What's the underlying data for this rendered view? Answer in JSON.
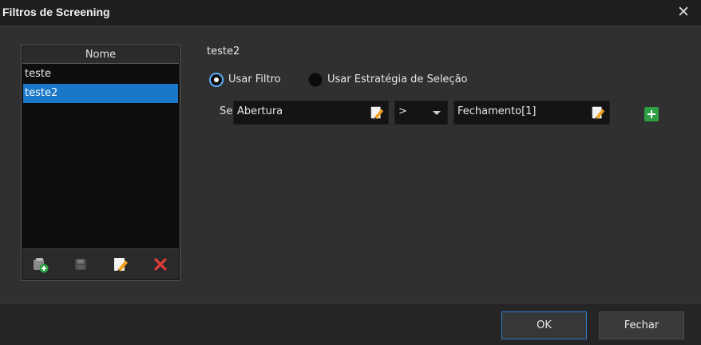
{
  "window": {
    "title": "Filtros de Screening"
  },
  "list": {
    "header": "Nome",
    "items": [
      {
        "label": "teste",
        "selected": false
      },
      {
        "label": "teste2",
        "selected": true
      }
    ],
    "toolbar": {
      "icons": [
        "add-folder-icon",
        "save-icon",
        "edit-icon",
        "delete-icon"
      ]
    }
  },
  "filter": {
    "name": "teste2",
    "mode_options": [
      {
        "label": "Usar Filtro",
        "checked": true
      },
      {
        "label": "Usar Estratégia de Seleção",
        "checked": false
      }
    ],
    "condition": {
      "prefix": "Se",
      "left_operand": "Abertura",
      "operator": ">",
      "right_operand": "Fechamento[1]"
    }
  },
  "footer": {
    "ok_label": "OK",
    "close_label": "Fechar"
  },
  "colors": {
    "accent": "#1a78c8",
    "add": "#2ea043",
    "delete": "#e03b3b"
  }
}
